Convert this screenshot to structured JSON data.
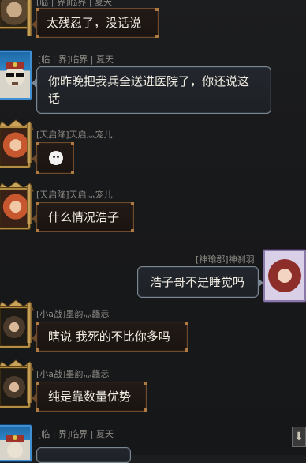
{
  "messages": [
    {
      "name": "[临 | 界]临界 | 夏天",
      "text": "太残忍了，没话说",
      "side": "left"
    },
    {
      "name": "[临 | 界]临界 | 夏天",
      "text_line1": "你昨晚把我兵全送进医院了，你还说这",
      "text_line2": "话",
      "side": "left"
    },
    {
      "name": "[天启降]天启灬宠儿",
      "emoji": "smiley-sticker",
      "side": "left"
    },
    {
      "name": "[天启降]天启灬宠儿",
      "text": "什么情况浩子",
      "side": "left"
    },
    {
      "name": "[神瑜郡]神刹羽",
      "text": "浩子哥不是睡觉吗",
      "side": "right"
    },
    {
      "name": "[小a战]墨韵灬龘忈",
      "text": "瞎说 我死的不比你多吗",
      "side": "left"
    },
    {
      "name": "[小a战]墨韵灬龘忈",
      "text": "纯是靠数量优势",
      "side": "left"
    },
    {
      "name": "[临 | 界]临界 | 夏天",
      "side": "left"
    }
  ],
  "scroll_button": {
    "icon": "arrow-down-icon",
    "glyph": "⬇"
  },
  "colors": {
    "background": "#1a1b1d",
    "name_text": "#8d8a84",
    "brown_border": "#6d4a2b",
    "slate_border": "#7c8794",
    "gold_frame": "#b48d44",
    "blue_frame": "#3f8fd2"
  }
}
